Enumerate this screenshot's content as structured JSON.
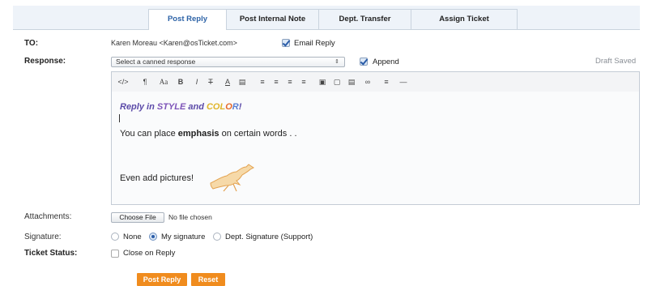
{
  "tabs": [
    "Post Reply",
    "Post Internal Note",
    "Dept. Transfer",
    "Assign Ticket"
  ],
  "form": {
    "to_label": "TO:",
    "to_value": "Karen Moreau <Karen@osTicket.com>",
    "email_reply_label": "Email Reply",
    "response_label": "Response:",
    "canned_placeholder": "Select a canned response",
    "append_label": "Append",
    "draft_status": "Draft Saved",
    "attachments_label": "Attachments:",
    "choose_file_label": "Choose File",
    "no_file_text": "No file chosen",
    "signature_label": "Signature:",
    "sig_none": "None",
    "sig_my": "My signature",
    "sig_dept": "Dept. Signature (Support)",
    "ticket_status_label": "Ticket Status:",
    "close_on_reply": "Close on Reply",
    "post_reply_button": "Post Reply",
    "reset_button": "Reset"
  },
  "editor": {
    "toolbar": [
      "</>",
      "¶",
      "Aa",
      "B",
      "I",
      "T",
      "A",
      "▤",
      "≡",
      "≡",
      "≡",
      "≡",
      "▣",
      "▢",
      "▤",
      "∞",
      "≡",
      "—"
    ],
    "title_segments": [
      {
        "text": "Reply in ",
        "color": "#5b4aa8"
      },
      {
        "text": "STYLE",
        "color": "#7d53b8"
      },
      {
        "text": " and ",
        "color": "#5b4aa8"
      },
      {
        "text": "COL",
        "color": "#e0b52a"
      },
      {
        "text": "O",
        "color": "#e66a2a"
      },
      {
        "text": "R",
        "color": "#5b7fd1"
      },
      {
        "text": "!",
        "color": "#5b4aa8"
      }
    ],
    "line_before": "You can place ",
    "emphasis": "emphasis",
    "line_after": " on certain words . .",
    "pictures_text": "Even add pictures!"
  },
  "colors": {
    "tab_active_text": "#2d63a7",
    "button_orange": "#f08c1e",
    "checkbox_blue": "#2a5ca8"
  }
}
